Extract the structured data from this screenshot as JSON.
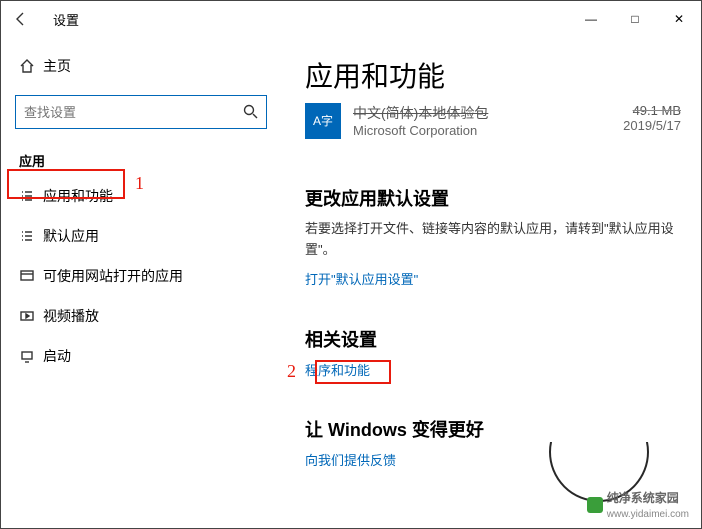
{
  "window": {
    "title": "设置",
    "controls": {
      "min": "—",
      "max": "□",
      "close": "✕"
    }
  },
  "sidebar": {
    "home": "主页",
    "search_placeholder": "查找设置",
    "section": "应用",
    "items": [
      {
        "label": "应用和功能"
      },
      {
        "label": "默认应用"
      },
      {
        "label": "可使用网站打开的应用"
      },
      {
        "label": "视频播放"
      },
      {
        "label": "启动"
      }
    ]
  },
  "main": {
    "heading": "应用和功能",
    "app": {
      "name_struck": "中文(简体)本地体验包",
      "publisher": "Microsoft Corporation",
      "size_struck": "49.1 MB",
      "date": "2019/5/17",
      "tile_letter": "A字"
    },
    "change_defaults": {
      "title": "更改应用默认设置",
      "text": "若要选择打开文件、链接等内容的默认应用，请转到\"默认应用设置\"。",
      "link": "打开\"默认应用设置\""
    },
    "related": {
      "title": "相关设置",
      "link": "程序和功能"
    },
    "improve": {
      "title": "让 Windows 变得更好",
      "link": "向我们提供反馈"
    }
  },
  "annotations": {
    "one": "1",
    "two": "2"
  },
  "watermark": {
    "brand": "纯净系统家园",
    "url": "www.yidaimei.com"
  }
}
